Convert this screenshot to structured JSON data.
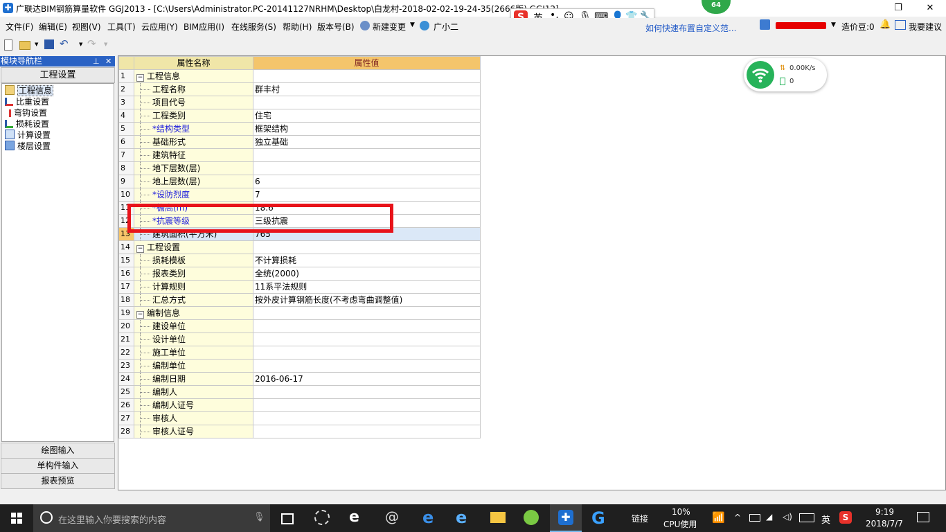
{
  "titlebar": {
    "title": "广联达BIM钢筋算量软件 GGJ2013 - [C:\\Users\\Administrator.PC-20141127NRHM\\Desktop\\白龙村-2018-02-02-19-24-35(2666版).GGJ12]",
    "app_icon_glyph": "✚",
    "restore_glyph": "❐",
    "close_glyph": "✕"
  },
  "badge": {
    "value": "64"
  },
  "ime": {
    "lang": "英",
    "punct": "•,"
  },
  "menubar": {
    "items": [
      "文件(F)",
      "编辑(E)",
      "视图(V)",
      "工具(T)",
      "云应用(Y)",
      "BIM应用(I)",
      "在线服务(S)",
      "帮助(H)",
      "版本号(B)"
    ],
    "new_change": "新建变更",
    "assistant": "广小二",
    "promo": "如何快速布置自定义范...",
    "cost_beans": "造价豆:0",
    "suggest": "我要建议"
  },
  "nav": {
    "title": "模块导航栏",
    "pin_glyph": "⊥",
    "close_glyph": "✕",
    "tab": "工程设置",
    "items": [
      "工程信息",
      "比重设置",
      "弯钩设置",
      "损耗设置",
      "计算设置",
      "楼层设置"
    ],
    "bottom": [
      "绘图输入",
      "单构件输入",
      "报表预览"
    ]
  },
  "table": {
    "header_name": "属性名称",
    "header_value": "属性值",
    "rows": [
      {
        "n": "1",
        "name": "工程信息",
        "value": "",
        "group": true
      },
      {
        "n": "2",
        "name": "工程名称",
        "value": "群丰村"
      },
      {
        "n": "3",
        "name": "项目代号",
        "value": ""
      },
      {
        "n": "4",
        "name": "工程类别",
        "value": "住宅"
      },
      {
        "n": "5",
        "name": "*结构类型",
        "value": "框架结构",
        "blue": true
      },
      {
        "n": "6",
        "name": "基础形式",
        "value": "独立基础"
      },
      {
        "n": "7",
        "name": "建筑特征",
        "value": ""
      },
      {
        "n": "8",
        "name": "地下层数(层)",
        "value": ""
      },
      {
        "n": "9",
        "name": "地上层数(层)",
        "value": "6"
      },
      {
        "n": "10",
        "name": "*设防烈度",
        "value": "7",
        "blue": true
      },
      {
        "n": "11",
        "name": "*檐高(m)",
        "value": "18.6",
        "blue": true
      },
      {
        "n": "12",
        "name": "*抗震等级",
        "value": "三级抗震",
        "blue": true
      },
      {
        "n": "13",
        "name": "建筑面积(平方米)",
        "value": "765",
        "selected": true
      },
      {
        "n": "14",
        "name": "工程设置",
        "value": "",
        "group": true
      },
      {
        "n": "15",
        "name": "损耗模板",
        "value": "不计算损耗"
      },
      {
        "n": "16",
        "name": "报表类别",
        "value": "全统(2000)"
      },
      {
        "n": "17",
        "name": "计算规则",
        "value": "11系平法规则"
      },
      {
        "n": "18",
        "name": "汇总方式",
        "value": "按外皮计算钢筋长度(不考虑弯曲调整值)"
      },
      {
        "n": "19",
        "name": "编制信息",
        "value": "",
        "group": true
      },
      {
        "n": "20",
        "name": "建设单位",
        "value": ""
      },
      {
        "n": "21",
        "name": "设计单位",
        "value": ""
      },
      {
        "n": "22",
        "name": "施工单位",
        "value": ""
      },
      {
        "n": "23",
        "name": "编制单位",
        "value": ""
      },
      {
        "n": "24",
        "name": "编制日期",
        "value": "2016-06-17"
      },
      {
        "n": "25",
        "name": "编制人",
        "value": ""
      },
      {
        "n": "26",
        "name": "编制人证号",
        "value": ""
      },
      {
        "n": "27",
        "name": "审核人",
        "value": ""
      },
      {
        "n": "28",
        "name": "审核人证号",
        "value": ""
      }
    ]
  },
  "wifi_widget": {
    "speed": "0.00K/s",
    "devices": "0"
  },
  "taskbar": {
    "search_placeholder": "在这里输入你要搜索的内容",
    "link_label": "链接",
    "cpu_percent": "10%",
    "cpu_label": "CPU使用",
    "lang": "英",
    "time": "9:19",
    "date": "2018/7/7"
  },
  "colors": {
    "nav_header": "#2a62c4",
    "name_column": "#fefddc",
    "value_header": "#f4c56b",
    "highlight_box": "#e8131a",
    "required_field": "#1a1adc"
  }
}
